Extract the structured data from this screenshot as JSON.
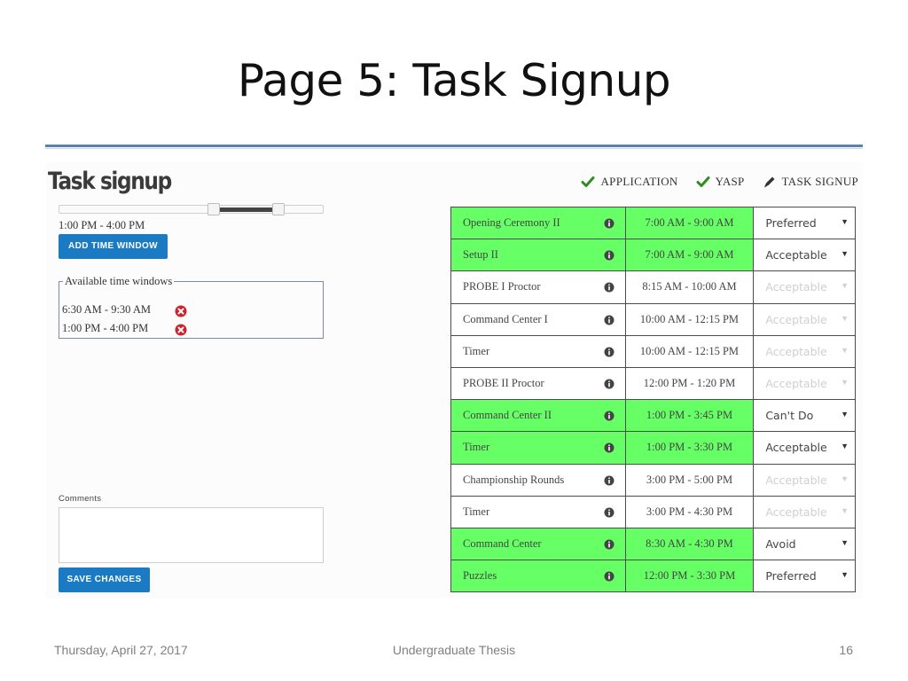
{
  "slide": {
    "title": "Page 5: Task Signup",
    "footer_date": "Thursday, April 27, 2017",
    "footer_center": "Undergraduate Thesis",
    "page_number": "16"
  },
  "app": {
    "title": "Task signup",
    "steps": [
      {
        "label": "APPLICATION",
        "icon": "checkmark-icon"
      },
      {
        "label": "YASP",
        "icon": "checkmark-icon"
      },
      {
        "label": "TASK SIGNUP",
        "icon": "pencil-icon"
      }
    ],
    "slider_label": "1:00 PM - 4:00 PM",
    "add_button": "ADD TIME WINDOW",
    "windows_legend": "Available time windows",
    "windows": [
      "6:30 AM - 9:30 AM",
      "1:00 PM - 4:00 PM"
    ],
    "comments_label": "Comments",
    "comments_value": "",
    "save_button": "SAVE CHANGES"
  },
  "colors": {
    "available": "#66ff66",
    "button": "#1a7ac3",
    "check": "#2e8b1e",
    "remove": "#d0202a"
  },
  "tasks": [
    {
      "name": "Opening Ceremony II",
      "time": "7:00 AM - 9:00 AM",
      "preference": "Preferred",
      "available": true
    },
    {
      "name": "Setup II",
      "time": "7:00 AM - 9:00 AM",
      "preference": "Acceptable",
      "available": true
    },
    {
      "name": "PROBE I Proctor",
      "time": "8:15 AM - 10:00 AM",
      "preference": "Acceptable",
      "available": false
    },
    {
      "name": "Command Center I",
      "time": "10:00 AM - 12:15 PM",
      "preference": "Acceptable",
      "available": false
    },
    {
      "name": "Timer",
      "time": "10:00 AM - 12:15 PM",
      "preference": "Acceptable",
      "available": false
    },
    {
      "name": "PROBE II Proctor",
      "time": "12:00 PM - 1:20 PM",
      "preference": "Acceptable",
      "available": false
    },
    {
      "name": "Command Center II",
      "time": "1:00 PM - 3:45 PM",
      "preference": "Can't Do",
      "available": true
    },
    {
      "name": "Timer",
      "time": "1:00 PM - 3:30 PM",
      "preference": "Acceptable",
      "available": true
    },
    {
      "name": "Championship Rounds",
      "time": "3:00 PM - 5:00 PM",
      "preference": "Acceptable",
      "available": false
    },
    {
      "name": "Timer",
      "time": "3:00 PM - 4:30 PM",
      "preference": "Acceptable",
      "available": false
    },
    {
      "name": "Command Center",
      "time": "8:30 AM - 4:30 PM",
      "preference": "Avoid",
      "available": true
    },
    {
      "name": "Puzzles",
      "time": "12:00 PM - 3:30 PM",
      "preference": "Preferred",
      "available": true
    }
  ]
}
